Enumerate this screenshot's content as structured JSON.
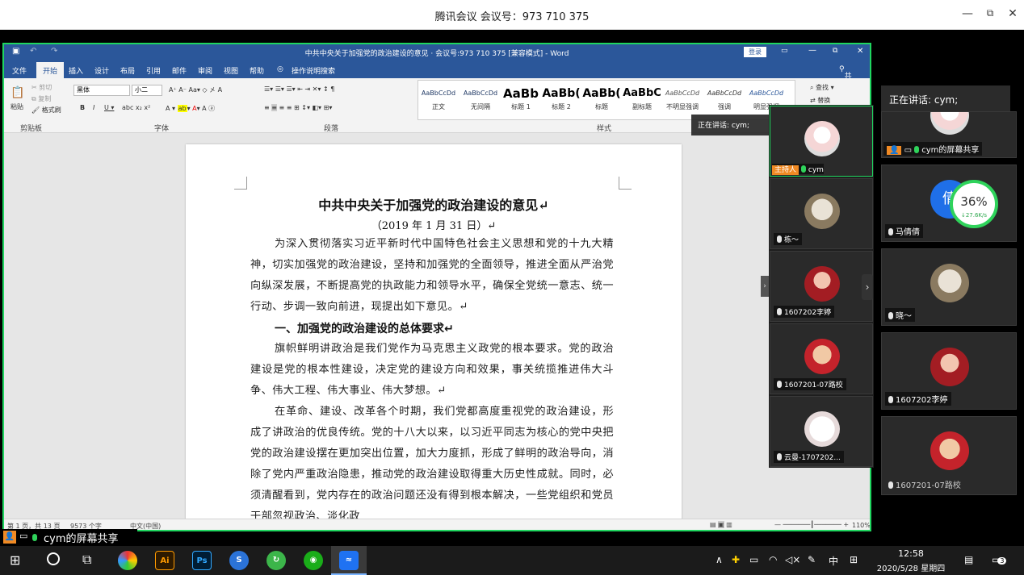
{
  "meeting": {
    "title": "腾讯会议 会议号：973 710 375",
    "minimize": "—",
    "restore": "⧉",
    "close": "✕"
  },
  "word": {
    "title": "中共中央关于加强党的政治建设的意见 · 会议号:973 710 375 [兼容模式] - Word",
    "login": "登录",
    "share": "共享",
    "tabs": [
      "文件",
      "开始",
      "插入",
      "设计",
      "布局",
      "引用",
      "邮件",
      "审阅",
      "视图",
      "帮助"
    ],
    "tell_me": "操作说明搜索",
    "clipboard": {
      "paste": "粘贴",
      "cut": "剪切",
      "copy": "复制",
      "painter": "格式刷",
      "label": "剪贴板"
    },
    "font": {
      "name": "黑体",
      "size": "小二",
      "label": "字体"
    },
    "paragraph_label": "段落",
    "styles_label": "样式",
    "styles": [
      {
        "sample": "AaBbCcDd",
        "name": "正文"
      },
      {
        "sample": "AaBbCcDd",
        "name": "无间隔"
      },
      {
        "sample": "AaBb",
        "name": "标题 1"
      },
      {
        "sample": "AaBb(",
        "name": "标题 2"
      },
      {
        "sample": "AaBb(",
        "name": "标题"
      },
      {
        "sample": "AaBbC",
        "name": "副标题"
      },
      {
        "sample": "AaBbCcDd",
        "name": "不明显强调"
      },
      {
        "sample": "AaBbCcDd",
        "name": "强调"
      },
      {
        "sample": "AaBbCcDd",
        "name": "明显强调"
      }
    ],
    "find": "查找",
    "replace": "替换",
    "doc": {
      "heading": "中共中央关于加强党的政治建设的意见↵",
      "date": "（2019 年 1 月 31 日）↵",
      "p1": "为深入贯彻落实习近平新时代中国特色社会主义思想和党的十九大精神，切实加强党的政治建设，坚持和加强党的全面领导，推进全面从严治党向纵深发展，不断提高党的执政能力和领导水平，确保全党统一意志、统一行动、步调一致向前进，现提出如下意见。↵",
      "h2": "一、加强党的政治建设的总体要求↵",
      "p2": "旗帜鲜明讲政治是我们党作为马克思主义政党的根本要求。党的政治建设是党的根本性建设，决定党的建设方向和效果，事关统揽推进伟大斗争、伟大工程、伟大事业、伟大梦想。↵",
      "p3": "在革命、建设、改革各个时期，我们党都高度重视党的政治建设，形成了讲政治的优良传统。党的十八大以来，以习近平同志为核心的党中央把党的政治建设摆在更加突出位置，加大力度抓，形成了鲜明的政治导向，消除了党内严重政治隐患，推动党的政治建设取得重大历史性成就。同时，必须清醒看到，党内存在的政治问题还没有得到根本解决，一些党组织和党员干部忽视政治、淡化政"
    },
    "status": {
      "page": "第 1 页，共 13 页",
      "words": "9573 个字",
      "lang": "中文(中国)",
      "zoom": "110%"
    }
  },
  "speaking_small": "正在讲话: cym;",
  "speaking_big": "正在讲话: cym;",
  "mid_tiles": [
    {
      "name": "cym",
      "host": "主持人"
    },
    {
      "name": "栋～"
    },
    {
      "name": "1607202李婷"
    },
    {
      "name": "1607201-07路校"
    },
    {
      "name": "云曼-1707202..."
    }
  ],
  "right_tiles": [
    {
      "name": "cym的屏幕共享"
    },
    {
      "name": "马倩倩",
      "avatar_text": "倩"
    },
    {
      "name": "晓～"
    },
    {
      "name": "1607202李婷"
    },
    {
      "name": "1607201-07路校"
    }
  ],
  "net": {
    "percent": "36%",
    "speed": "↓27.6K/s"
  },
  "share_label": "cym的屏幕共享",
  "taskbar": {
    "time": "12:58",
    "date": "2020/5/28 星期四",
    "ime": "中",
    "notif_count": "3",
    "apps": [
      "Ai",
      "Ps"
    ]
  },
  "colors": {
    "word_blue": "#2b579a",
    "share_green": "#1fd65f",
    "host_orange": "#f08a24"
  }
}
